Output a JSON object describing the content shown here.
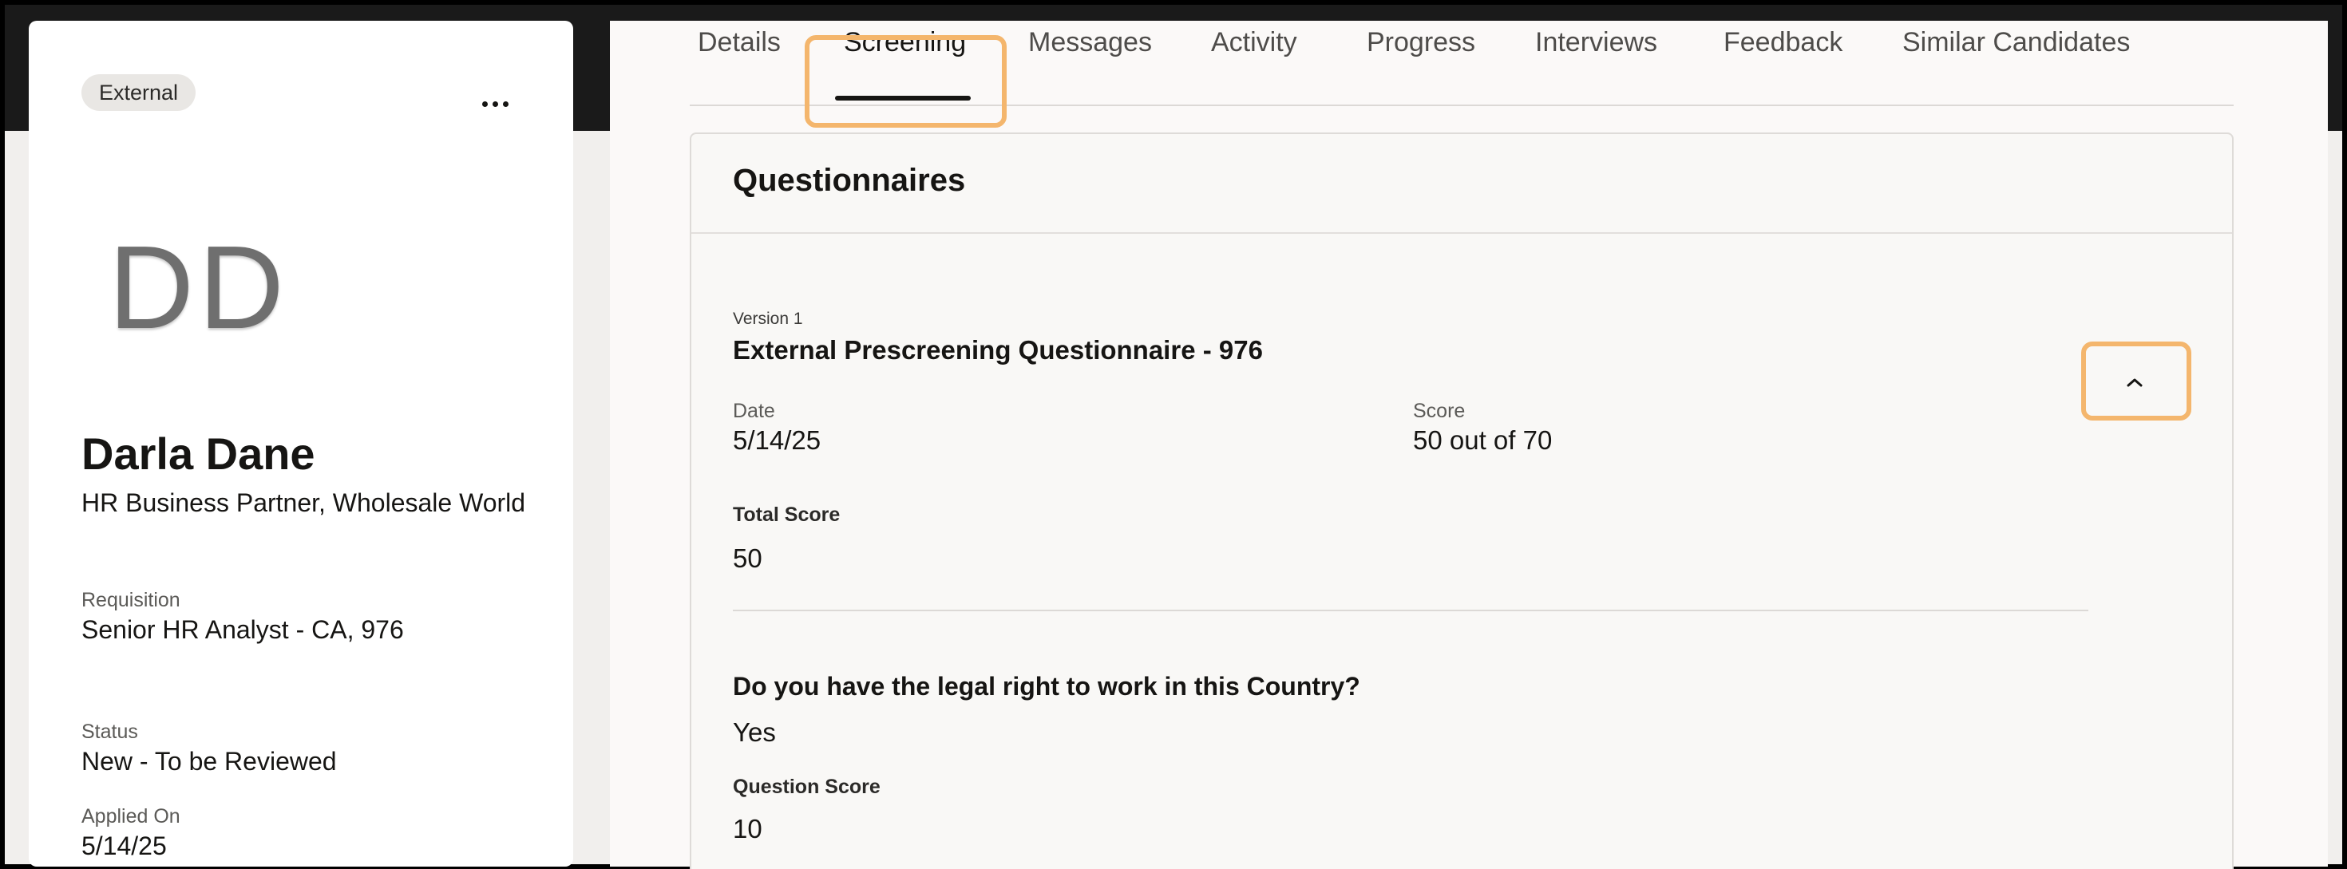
{
  "candidate": {
    "badge": "External",
    "initials": "DD",
    "name": "Darla Dane",
    "title": "HR Business Partner, Wholesale World",
    "requisition_label": "Requisition",
    "requisition": "Senior HR Analyst - CA, 976",
    "status_label": "Status",
    "status": "New - To be Reviewed",
    "applied_label": "Applied On",
    "applied": "5/14/25",
    "more_icon": "more-horizontal-icon"
  },
  "tabs": [
    {
      "label": "Details"
    },
    {
      "label": "Screening",
      "active": true
    },
    {
      "label": "Messages"
    },
    {
      "label": "Activity"
    },
    {
      "label": "Progress"
    },
    {
      "label": "Interviews"
    },
    {
      "label": "Feedback"
    },
    {
      "label": "Similar Candidates"
    }
  ],
  "questionnaires": {
    "title": "Questionnaires",
    "version": "Version 1",
    "name": "External Prescreening Questionnaire - 976",
    "date_label": "Date",
    "date": "5/14/25",
    "score_label": "Score",
    "score": "50 out of 70",
    "total_score_label": "Total Score",
    "total_score": "50",
    "collapse_icon": "chevron-up-icon",
    "question": {
      "text": "Do you have the legal right to work in this Country?",
      "answer": "Yes",
      "score_label": "Question Score",
      "score": "10"
    }
  },
  "colors": {
    "highlight": "#f4b66d",
    "panel_bg": "#fbf9f8",
    "page_bg": "#f1efed",
    "text": "#161513"
  }
}
